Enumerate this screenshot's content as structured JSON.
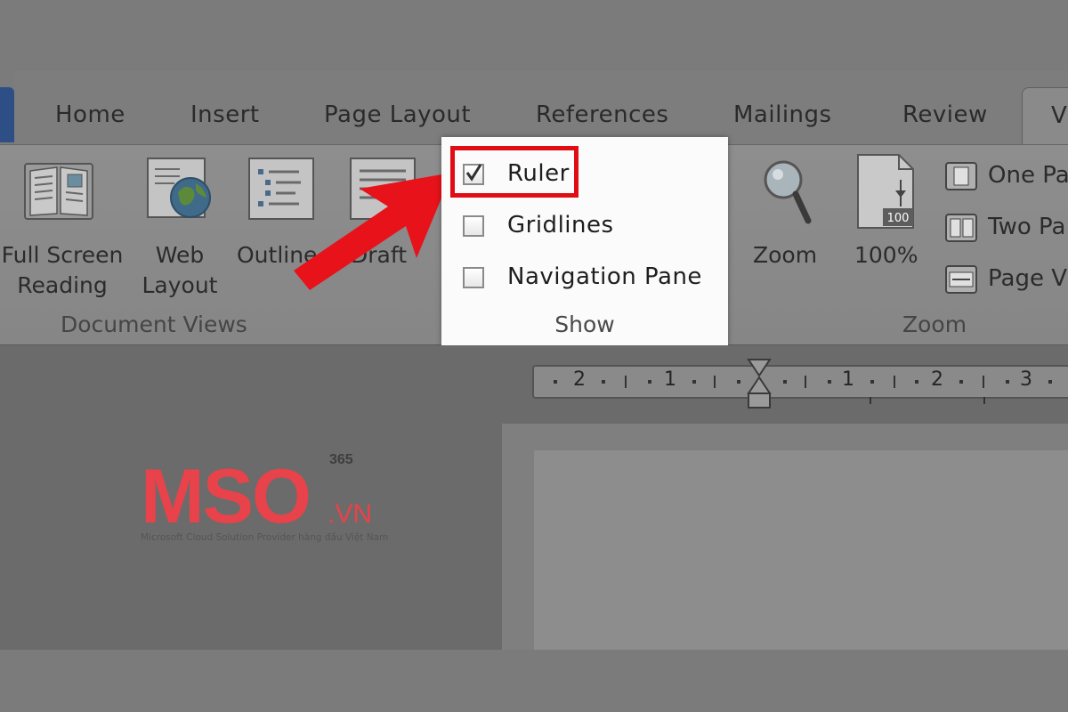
{
  "tabs": [
    {
      "label": "Home"
    },
    {
      "label": "Insert"
    },
    {
      "label": "Page Layout"
    },
    {
      "label": "References"
    },
    {
      "label": "Mailings"
    },
    {
      "label": "Review"
    }
  ],
  "active_tab": {
    "label": "V"
  },
  "document_views": {
    "group_label": "Document Views",
    "buttons": [
      {
        "label_line1": "Full Screen",
        "label_line2": "Reading",
        "icon": "open-book-icon"
      },
      {
        "label_line1": "Web",
        "label_line2": "Layout",
        "icon": "globe-page-icon"
      },
      {
        "label_line1": "Outline",
        "label_line2": "",
        "icon": "outline-icon"
      },
      {
        "label_line1": "Draft",
        "label_line2": "",
        "icon": "draft-icon"
      }
    ]
  },
  "show": {
    "group_label": "Show",
    "items": [
      {
        "label": "Ruler",
        "checked": true
      },
      {
        "label": "Gridlines",
        "checked": false
      },
      {
        "label": "Navigation Pane",
        "checked": false
      }
    ]
  },
  "zoom": {
    "group_label": "Zoom",
    "zoom_label": "Zoom",
    "percent_label": "100%",
    "percent_badge": "100",
    "one_page": "One Pa",
    "two_pages": "Two Pa",
    "page_width": "Page V"
  },
  "ruler": {
    "numbers": [
      "2",
      "1",
      "1",
      "2",
      "3"
    ]
  },
  "logo": {
    "wordmark": "MSO",
    "superscript": "365",
    "suffix": ".VN",
    "tagline": "Microsoft Cloud Solution Provider hàng đầu Việt Nam"
  },
  "colors": {
    "highlight": "#e00d14",
    "arrow": "#e8121a",
    "logo": "#e8424a"
  }
}
